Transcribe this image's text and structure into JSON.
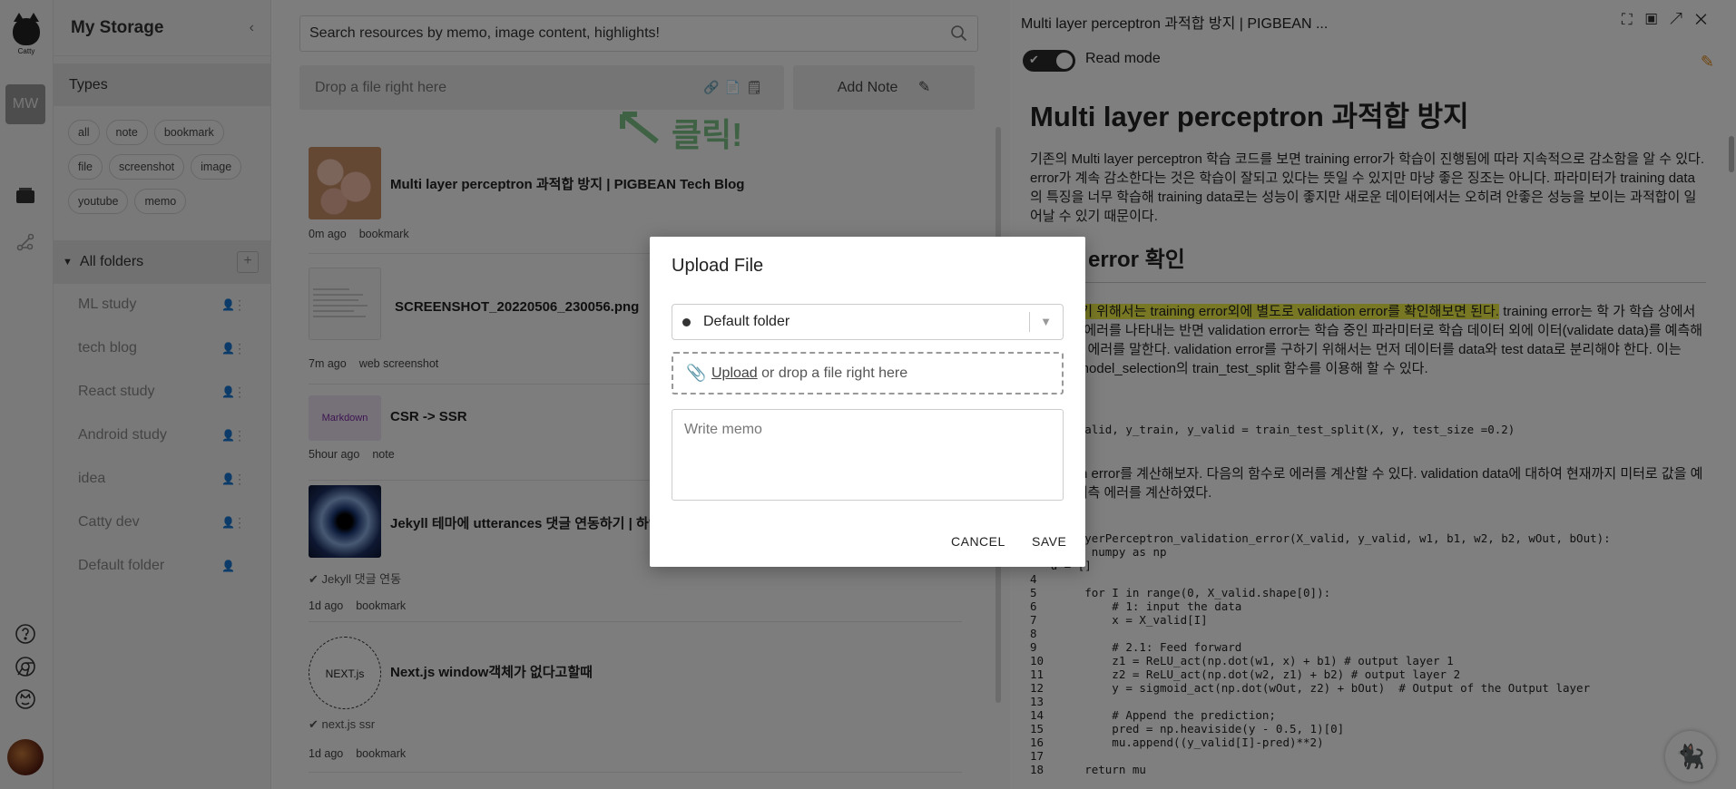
{
  "rail": {
    "logo_text": "Catty",
    "user_initials": "MW"
  },
  "storage": {
    "title": "My Storage",
    "types_label": "Types",
    "types": [
      "all",
      "note",
      "bookmark",
      "file",
      "screenshot",
      "image",
      "youtube",
      "memo"
    ],
    "all_folders_label": "All folders",
    "folders": [
      "ML study",
      "tech blog",
      "React study",
      "Android study",
      "idea",
      "Catty dev",
      "Default folder"
    ]
  },
  "list": {
    "search_placeholder": "Search resources by memo, image content, highlights!",
    "drop_label": "Drop a file right here",
    "add_note_label": "Add Note",
    "hint_text": "클릭!",
    "cards": [
      {
        "title": "Multi layer perceptron 과적합 방지 | PIGBEAN Tech Blog",
        "time": "0m ago",
        "type": "bookmark",
        "sub": ""
      },
      {
        "title": "SCREENSHOT_20220506_230056.png",
        "time": "7m ago",
        "type": "web screenshot",
        "sub": ""
      },
      {
        "title": "CSR -> SSR",
        "time": "5hour ago",
        "type": "note",
        "sub": "",
        "thumb_label": "Markdown"
      },
      {
        "title": "Jekyll 테마에 utterances 댓글 연동하기 | 하얀",
        "time": "1d ago",
        "type": "bookmark",
        "sub": "✔ Jekyll 댓글 연동"
      },
      {
        "title": "Next.js window객체가 없다고할때",
        "time": "1d ago",
        "type": "bookmark",
        "sub": "✔ next.js ssr",
        "thumb_label": "NEXT.js"
      }
    ]
  },
  "preview": {
    "tab_title": "Multi layer perceptron 과적합 방지 | PIGBEAN ...",
    "read_mode": "Read mode",
    "heading": "Multi layer perceptron 과적합 방지",
    "para1": "기존의 Multi layer perceptron 학습 코드를 보면 training error가 학습이 진행됨에 따라 지속적으로 감소함을 알 수 있다. error가 계속 감소한다는 것은 학습이 잘되고 있다는 뜻일 수 있지만 마냥 좋은 징조는 아니다. 파라미터가 training data의 특징을 너무 학습해 training data로는 성능이 좋지만 새로운 데이터에서는 오히려 안좋은 성능을 보이는 과적합이 일어날 수 있기 때문이다.",
    "subheading": "ation error 확인",
    "para2_hl": "확인해보기 위해서는 training error외에 별도로 validation error를 확인해보면 된다.",
    "para2_rest": " training error는 학 가 학습 상에서 발생하는 에러를 나타내는 반면 validation error는 학습 중인 파라미터로 학습 데이터 외에 이터(validate data)를 예측해서 나오는 에러를 말한다. validation error를 구하기 위해서는 먼저 데이터를 data와 test data로 분리해야 한다. 이는 sklearn.model_selection의 train_test_split 함수를 이용해 할 수 있다.",
    "code1": "ain, X_valid, y_train, y_valid = train_test_split(X, y, test_size =0.2)",
    "para3": "validation error를 계산해보자. 다음의 함수로 에러를 계산할 수 있다. validation data에 대하여 현재까지 미터로 값을 예측한 뒤 예측 에러를 계산하였다.",
    "code_lines": [
      "  hreeLayerPerceptron_validation_error(X_valid, y_valid, w1, b1, w2, b2, wOut, bOut):",
      "   mport numpy as np",
      "   u = []",
      "4",
      "5       for I in range(0, X_valid.shape[0]):",
      "6           # 1: input the data",
      "7           x = X_valid[I]",
      "8",
      "9           # 2.1: Feed forward",
      "10          z1 = ReLU_act(np.dot(w1, x) + b1) # output layer 1",
      "11          z2 = ReLU_act(np.dot(w2, z1) + b2) # output layer 2",
      "12          y = sigmoid_act(np.dot(wOut, z2) + bOut)  # Output of the Output layer",
      "13",
      "14          # Append the prediction;",
      "15          pred = np.heaviside(y - 0.5, 1)[0]",
      "16          mu.append((y_valid[I]-pred)**2)",
      "17",
      "18      return mu"
    ]
  },
  "dialog": {
    "title": "Upload File",
    "folder": "Default folder",
    "upload_link": "Upload",
    "upload_rest": " or drop a file right here",
    "memo_placeholder": "Write memo",
    "cancel": "CANCEL",
    "save": "SAVE"
  }
}
